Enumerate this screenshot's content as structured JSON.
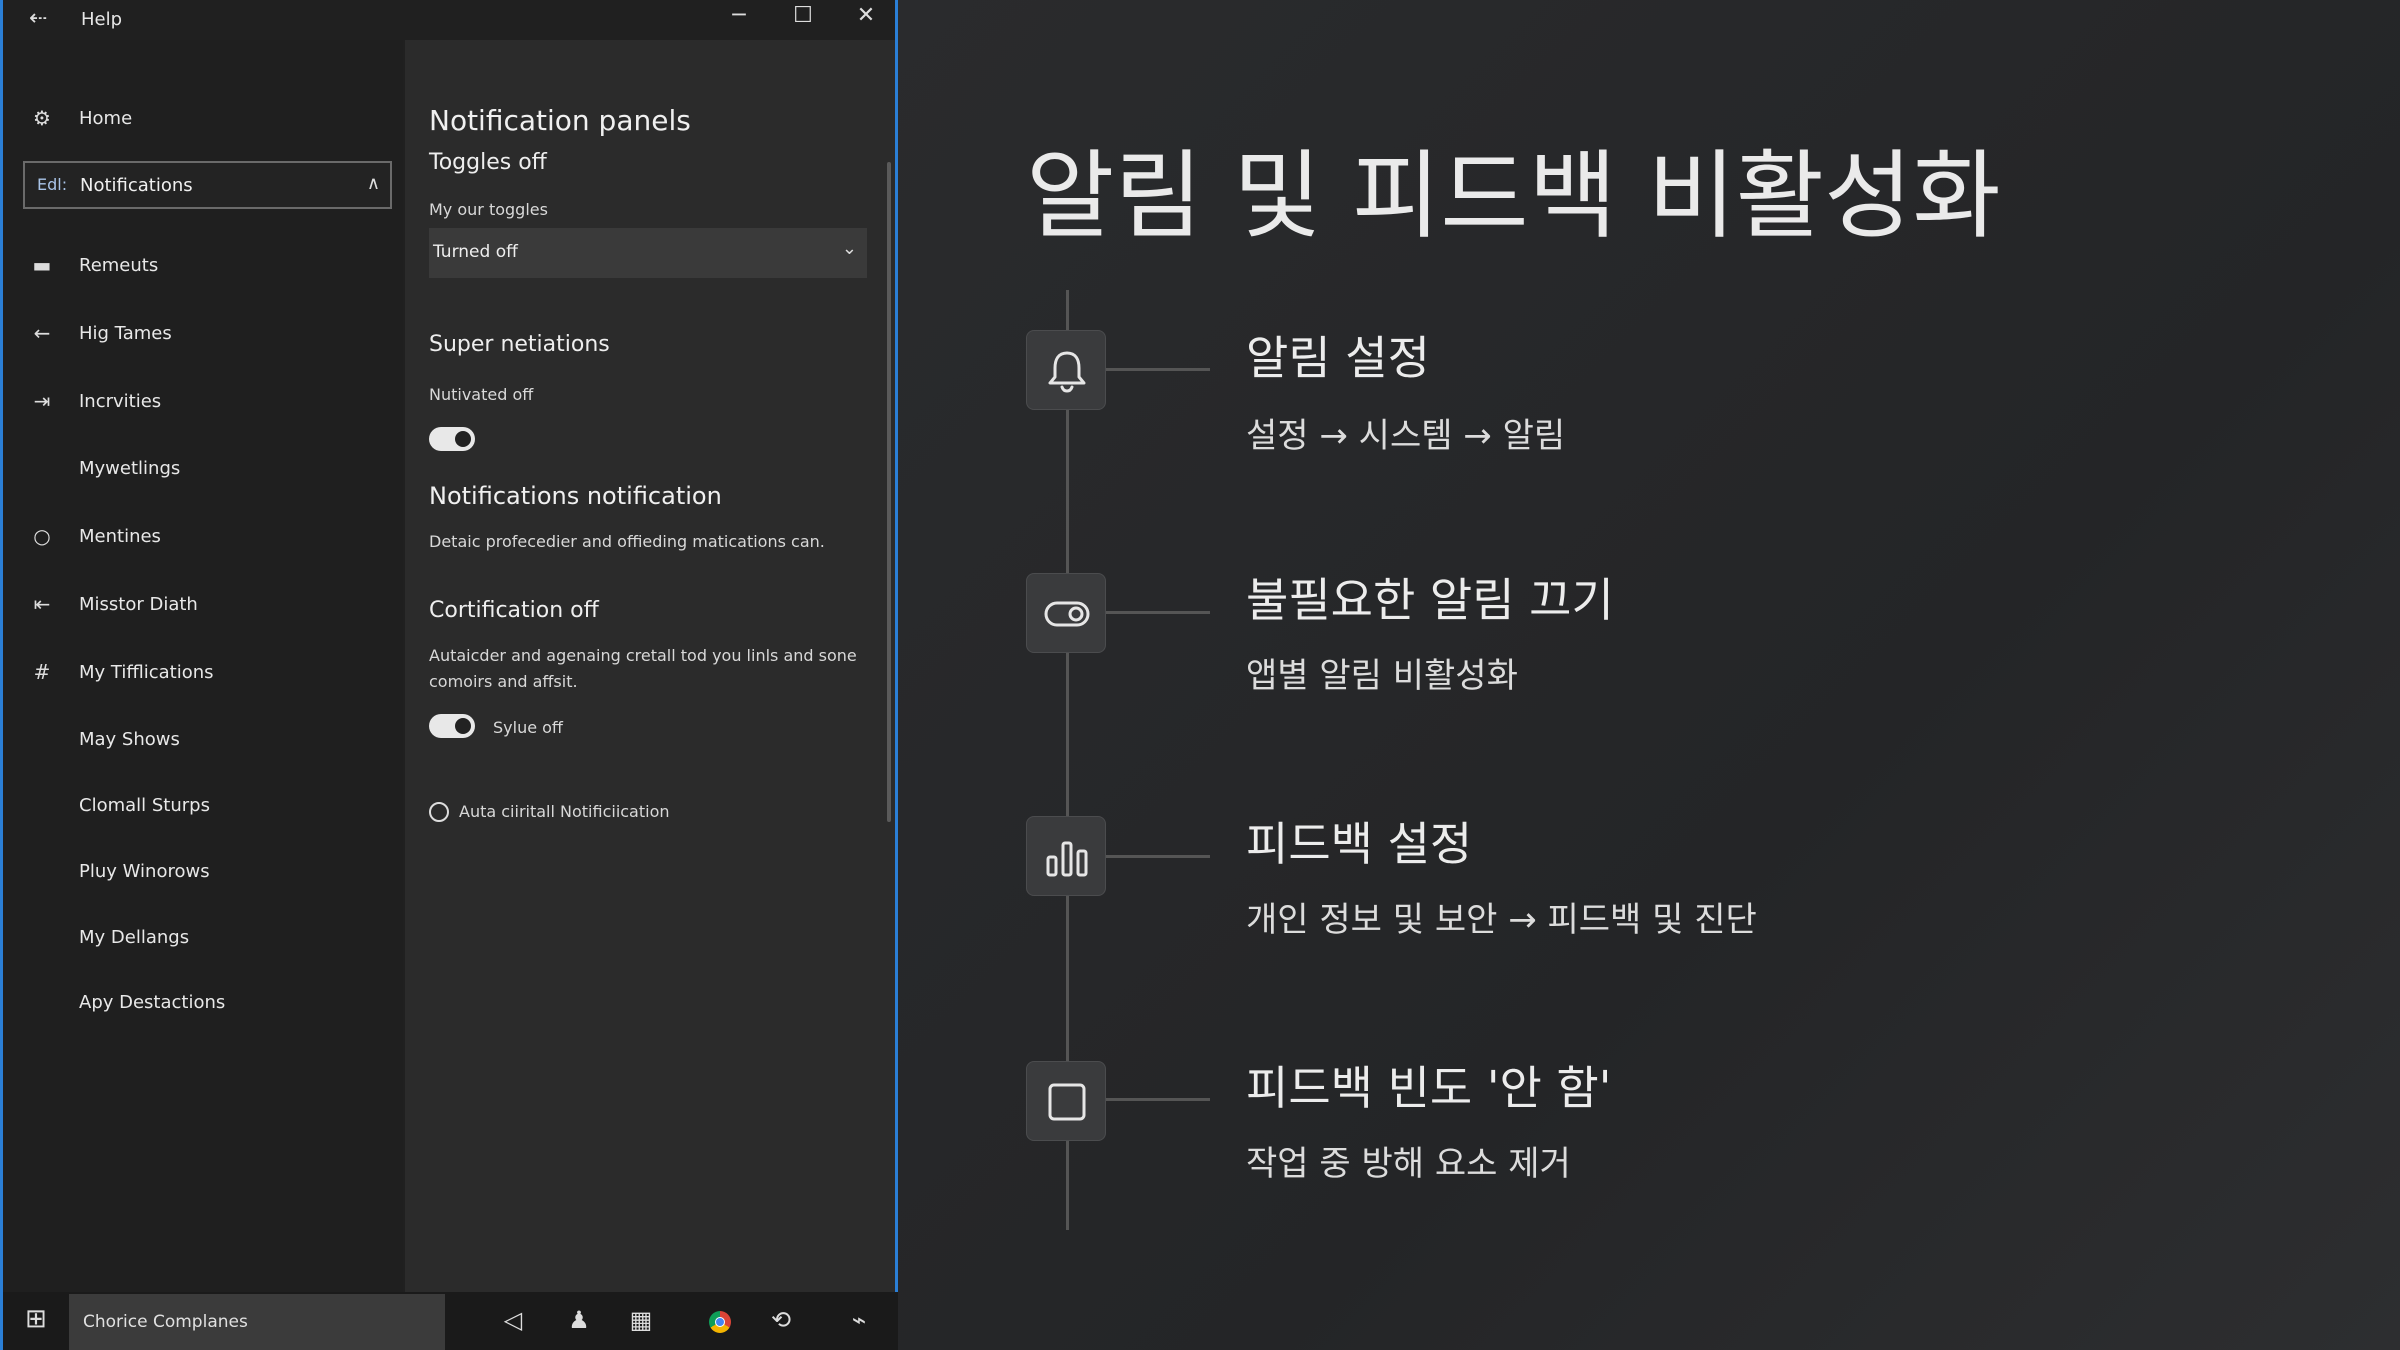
{
  "window": {
    "title": "Help",
    "minimize_glyph": "─",
    "maximize_glyph": "☐",
    "close_glyph": "✕"
  },
  "sidebar": {
    "items": [
      {
        "label": "Home",
        "icon": "gear-icon"
      },
      {
        "label": "Notifications",
        "prefix": "Edl:",
        "icon": "chevron-up-icon",
        "active": true
      },
      {
        "label": "Remeuts",
        "icon": "folder-icon"
      },
      {
        "label": "Hig Tames",
        "icon": "arrow-left-icon"
      },
      {
        "label": "Incrvities",
        "icon": "share-icon"
      },
      {
        "label": "Mywetlings",
        "icon": ""
      },
      {
        "label": "Mentines",
        "icon": "circle-icon"
      },
      {
        "label": "Misstor Diath",
        "icon": "arrow-icon"
      },
      {
        "label": "My Tifflications",
        "icon": "hash-icon"
      },
      {
        "label": "May Shows",
        "icon": ""
      },
      {
        "label": "Clomall Sturps",
        "icon": ""
      },
      {
        "label": "Pluy Winorows",
        "icon": ""
      },
      {
        "label": "My Dellangs",
        "icon": ""
      },
      {
        "label": "Apy Destactions",
        "icon": ""
      }
    ]
  },
  "content": {
    "title": "Notification panels",
    "subtitle": "Toggles off",
    "select_label": "My our toggles",
    "select_value": "Turned off",
    "section1_title": "Super netiations",
    "section1_label": "Nutivated off",
    "section1_toggle_on": true,
    "section2_title": "Notifications notification",
    "section2_desc": "Detaic profecedier and offieding matications can.",
    "section3_title": "Cortification off",
    "section3_desc_line1": "Autaicder and agenaing cretall tod you linls and sone",
    "section3_desc_line2": "comoirs and affsit.",
    "section3_toggle_label": "Sylue off",
    "section3_toggle_on": true,
    "radio_label": "Auta ciiritall Notificiication"
  },
  "taskbar": {
    "search_text": "Chorice Complanes",
    "icons": [
      "windows-start-icon",
      "back-triangle-icon",
      "user-icon",
      "calendar-icon",
      "chrome-icon",
      "refresh-icon",
      "network-icon"
    ]
  },
  "slide": {
    "title": "알림 및 피드백 비활성화",
    "steps": [
      {
        "title": "알림 설정",
        "subtitle": "설정 → 시스템 → 알림",
        "icon": "bell-icon"
      },
      {
        "title": "불필요한 알림 끄기",
        "subtitle": "앱별 알림 비활성화",
        "icon": "toggle-icon"
      },
      {
        "title": "피드백 설정",
        "subtitle": "개인 정보 및 보안 → 피드백 및 진단",
        "icon": "bar-chart-icon"
      },
      {
        "title": "피드백 빈도 '안 함'",
        "subtitle": "작업 중 방해 요소 제거",
        "icon": "square-icon"
      }
    ]
  }
}
